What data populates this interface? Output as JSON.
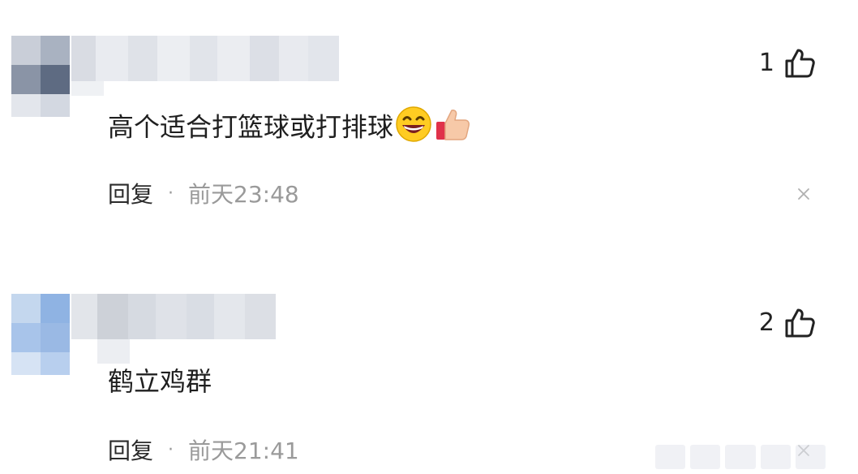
{
  "comments": [
    {
      "text": "高个适合打篮球或打排球",
      "emojis": [
        "grinning-face-emoji",
        "thumbs-up-emoji"
      ],
      "likes": "1",
      "reply_label": "回复",
      "separator": "·",
      "timestamp": "前天23:48"
    },
    {
      "text": "鹤立鸡群",
      "emojis": [],
      "likes": "2",
      "reply_label": "回复",
      "separator": "·",
      "timestamp": "前天21:41"
    }
  ],
  "icons": {
    "like": "thumbs-up-outline-icon",
    "close": "close-x-icon"
  },
  "colors": {
    "text": "#1f1f1f",
    "meta": "#9a9a9a",
    "background": "#ffffff"
  }
}
